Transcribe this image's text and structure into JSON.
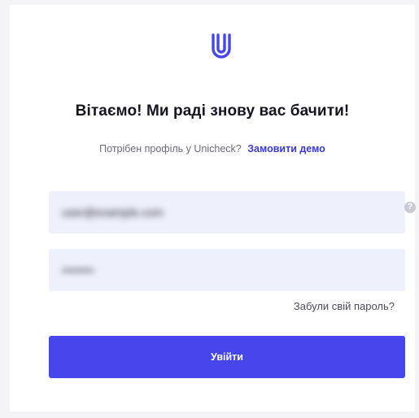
{
  "brand": {
    "logo_icon": "unicheck-logo-icon",
    "accent_color": "#4646ec"
  },
  "login": {
    "title": "Вітаємо! Ми раді знову вас бачити!",
    "subtitle_text": "Потрібен профіль у Unicheck?",
    "demo_link": "Замовити демо",
    "email_value": "user@example.com",
    "password_value": "••••••••",
    "help_icon": "?",
    "forgot_password": "Забули свій пароль?",
    "submit_label": "Увійти"
  }
}
